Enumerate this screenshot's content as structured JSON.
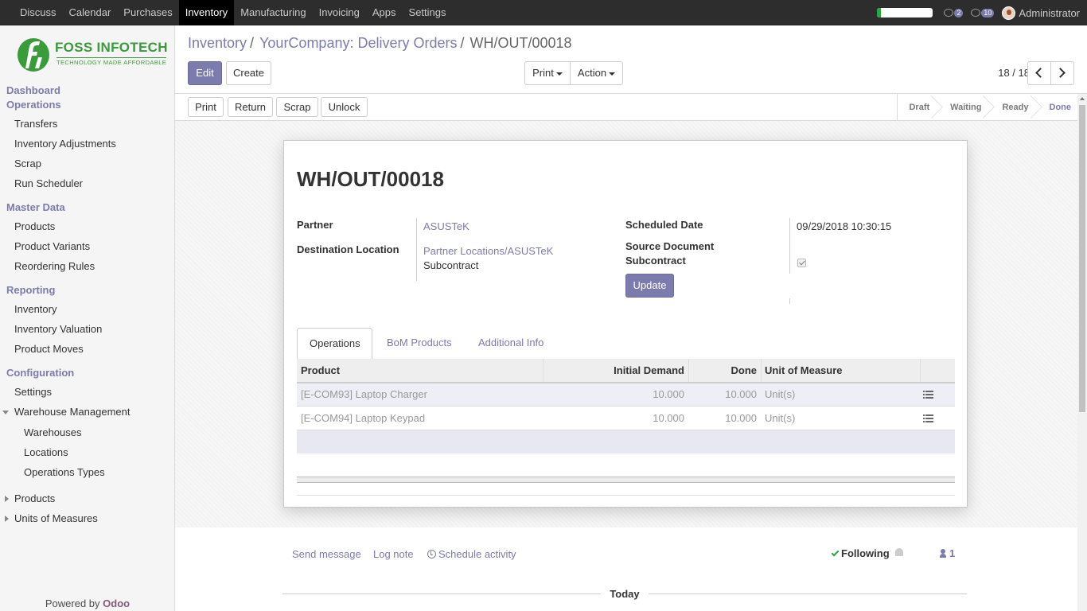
{
  "topbar": {
    "menu": [
      "Discuss",
      "Calendar",
      "Purchases",
      "Inventory",
      "Manufacturing",
      "Invoicing",
      "Apps",
      "Settings"
    ],
    "active_menu": "Inventory",
    "activity_count": "2",
    "message_count": "10",
    "user": "Administrator"
  },
  "sidebar": {
    "logo": {
      "name": "FOSS INFOTECH",
      "tagline": "TECHNOLOGY MADE AFFORDABLE"
    },
    "dashboard": "Dashboard",
    "operations": {
      "label": "Operations",
      "items": [
        "Transfers",
        "Inventory Adjustments",
        "Scrap",
        "Run Scheduler"
      ]
    },
    "master_data": {
      "label": "Master Data",
      "items": [
        "Products",
        "Product Variants",
        "Reordering Rules"
      ]
    },
    "reporting": {
      "label": "Reporting",
      "items": [
        "Inventory",
        "Inventory Valuation",
        "Product Moves"
      ]
    },
    "configuration": {
      "label": "Configuration",
      "settings": "Settings",
      "warehouse_management": "Warehouse Management",
      "warehouse_items": [
        "Warehouses",
        "Locations",
        "Operations Types"
      ],
      "products": "Products",
      "units_of_measures": "Units of Measures"
    },
    "powered_by": "Powered by",
    "powered_brand": "Odoo"
  },
  "breadcrumb": {
    "root": "Inventory",
    "parent": "YourCompany: Delivery Orders",
    "current": "WH/OUT/00018"
  },
  "control": {
    "edit": "Edit",
    "create": "Create",
    "print": "Print",
    "action": "Action",
    "pager": "18 / 18"
  },
  "statusbar": {
    "buttons": {
      "print": "Print",
      "return": "Return",
      "scrap": "Scrap",
      "unlock": "Unlock"
    },
    "stages": [
      "Draft",
      "Waiting",
      "Ready",
      "Done"
    ],
    "active_stage": "Done"
  },
  "form": {
    "title": "WH/OUT/00018",
    "partner_label": "Partner",
    "partner": "ASUSTeK",
    "destination_label": "Destination Location",
    "destination": "Partner Locations/ASUSTeK",
    "destination_sub": "Subcontract",
    "scheduled_label": "Scheduled Date",
    "scheduled": "09/29/2018 10:30:15",
    "source_label": "Source Document",
    "subcontract_label": "Subcontract",
    "subcontract_checked": true,
    "update": "Update"
  },
  "tabs": [
    "Operations",
    "BoM Products",
    "Additional Info"
  ],
  "table": {
    "headers": {
      "product": "Product",
      "initial_demand": "Initial Demand",
      "done": "Done",
      "uom": "Unit of Measure"
    },
    "rows": [
      {
        "product": "[E-COM93] Laptop Charger",
        "initial_demand": "10.000",
        "done": "10.000",
        "uom": "Unit(s)"
      },
      {
        "product": "[E-COM94] Laptop Keypad",
        "initial_demand": "10.000",
        "done": "10.000",
        "uom": "Unit(s)"
      }
    ]
  },
  "chatter": {
    "send_message": "Send message",
    "log_note": "Log note",
    "schedule_activity": "Schedule activity",
    "following": "Following",
    "followers": "1",
    "today": "Today"
  },
  "colors": {
    "brand": "#7c7bad",
    "navbar": "#2d2d2d",
    "logo_green": "#3a9b3a"
  },
  "progress_fraction": 0.06
}
